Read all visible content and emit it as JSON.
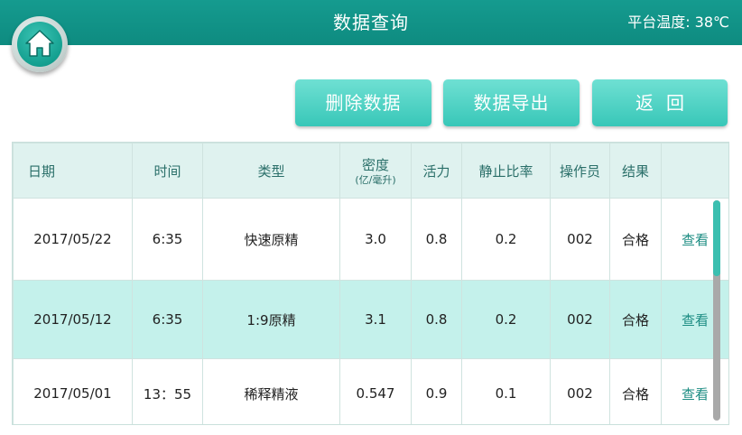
{
  "header": {
    "title": "数据查询",
    "temperature": "平台温度: 38℃"
  },
  "toolbar": {
    "delete_label": "删除数据",
    "export_label": "数据导出",
    "back_label": "返回"
  },
  "table": {
    "headers": {
      "date": "日期",
      "time": "时间",
      "type": "类型",
      "density": "密度",
      "density_unit": "(亿/毫升)",
      "motility": "活力",
      "static_ratio": "静止比率",
      "operator": "操作员",
      "result": "结果"
    },
    "rows": [
      {
        "date": "2017/05/22",
        "time": "6:35",
        "type": "快速原精",
        "density": "3.0",
        "motility": "0.8",
        "static_ratio": "0.2",
        "operator": "002",
        "result": "合格",
        "action": "查看"
      },
      {
        "date": "2017/05/12",
        "time": "6:35",
        "type": "1:9原精",
        "density": "3.1",
        "motility": "0.8",
        "static_ratio": "0.2",
        "operator": "002",
        "result": "合格",
        "action": "查看"
      },
      {
        "date": "2017/05/01",
        "time": "13：55",
        "type": "稀释精液",
        "density": "0.547",
        "motility": "0.9",
        "static_ratio": "0.1",
        "operator": "002",
        "result": "合格",
        "action": "查看"
      }
    ]
  },
  "icons": {
    "home": "home-icon"
  },
  "colors": {
    "header": "#0e8b80",
    "button": "#4fd3c4",
    "selected_row": "#c4f1eb",
    "accent_text": "#1d8d83"
  }
}
